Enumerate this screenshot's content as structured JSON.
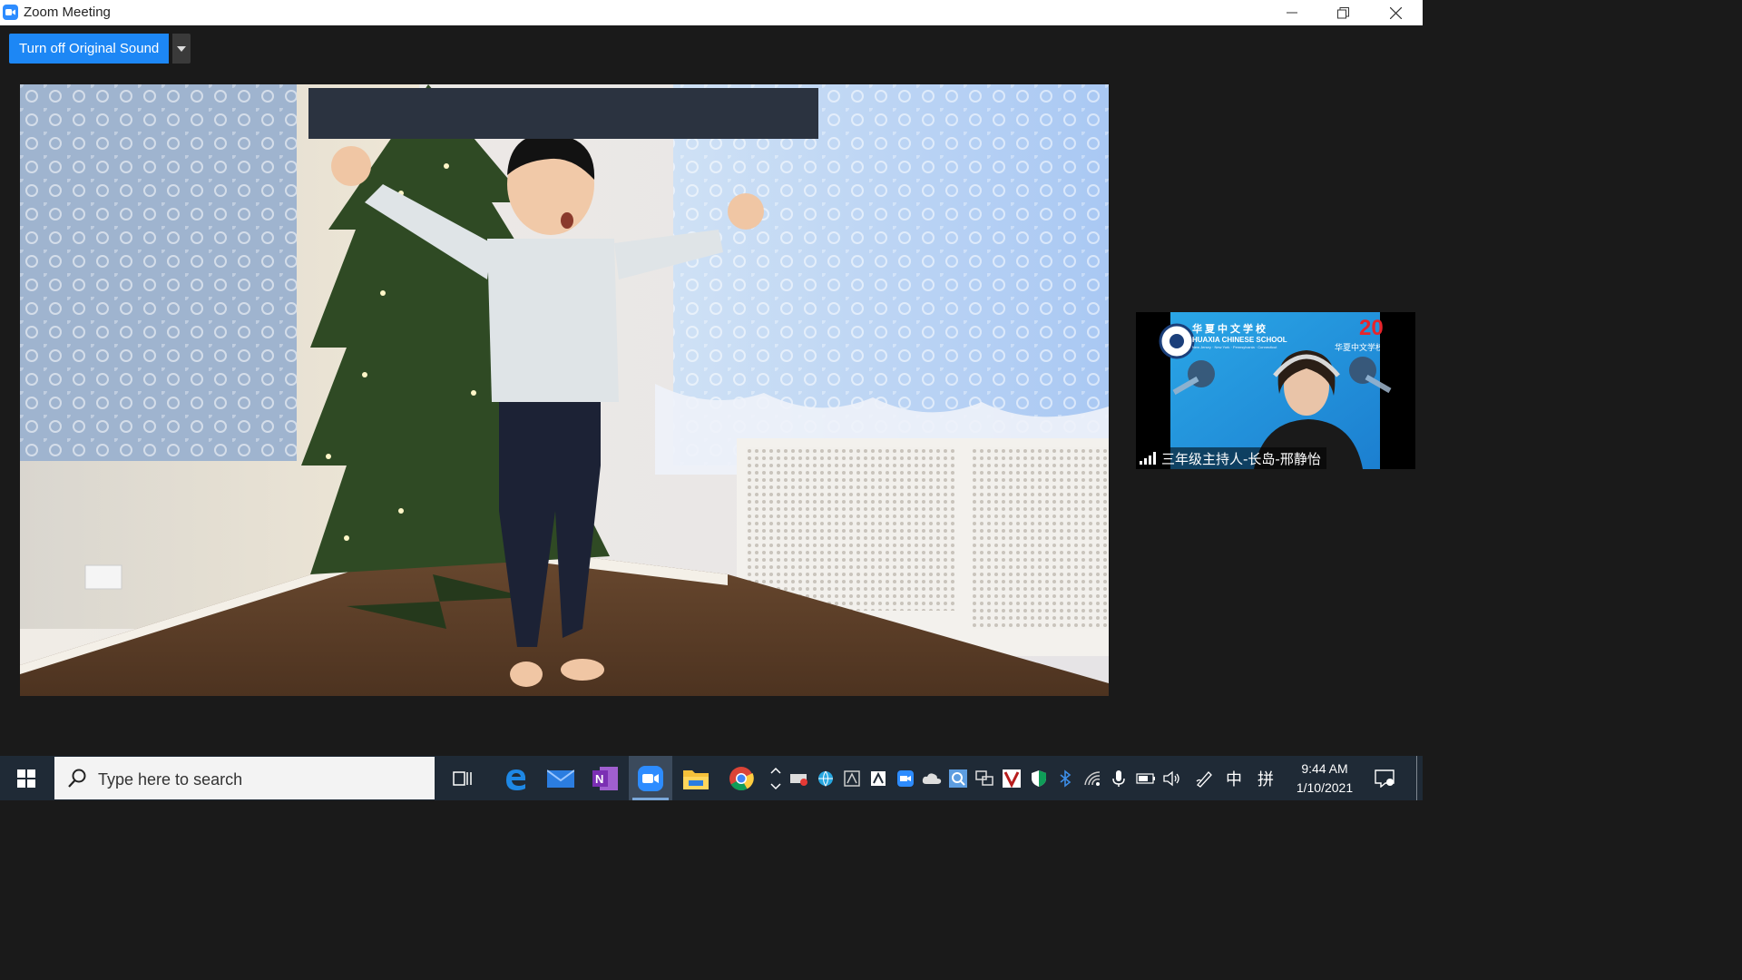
{
  "window": {
    "title": "Zoom Meeting"
  },
  "toolbar": {
    "original_sound_label": "Turn off Original Sound"
  },
  "thumbnail": {
    "participant_name": "三年级主持人-长岛-邢静怡",
    "logo_cn": "华夏中文学校",
    "logo_en": "HUAXIA CHINESE SCHOOL",
    "logo_sub": "New Jersey · New York · Pennsylvania · Connecticut",
    "corner_number": "20",
    "corner_text": "华夏中文学校"
  },
  "taskbar": {
    "search_placeholder": "Type here to search",
    "time": "9:44 AM",
    "date": "1/10/2021",
    "ime_lang": "中",
    "ime_mode": "拼"
  },
  "colors": {
    "zoom_blue": "#2d8cff",
    "button_blue": "#1d87f5",
    "taskbar": "#1f2a36"
  }
}
